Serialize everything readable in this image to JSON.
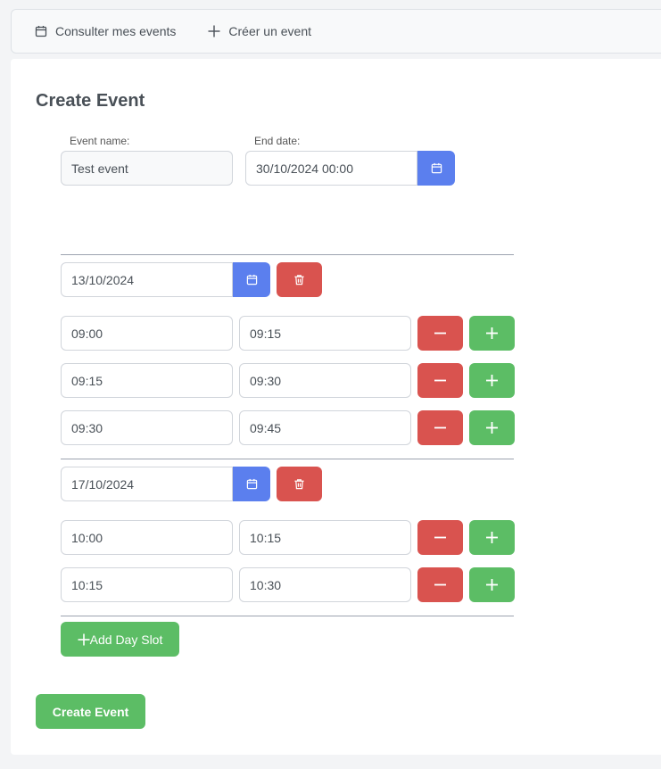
{
  "nav": {
    "view_events": "Consulter mes events",
    "create_event": "Créer un event"
  },
  "form": {
    "title": "Create Event",
    "event_name_label": "Event name:",
    "event_name_value": "Test event",
    "end_date_label": "End date:",
    "end_date_value": "30/10/2024 00:00"
  },
  "day_slots": [
    {
      "date": "13/10/2024",
      "slots": [
        {
          "start": "09:00",
          "end": "09:15"
        },
        {
          "start": "09:15",
          "end": "09:30"
        },
        {
          "start": "09:30",
          "end": "09:45"
        }
      ]
    },
    {
      "date": "17/10/2024",
      "slots": [
        {
          "start": "10:00",
          "end": "10:15"
        },
        {
          "start": "10:15",
          "end": "10:30"
        }
      ]
    }
  ],
  "buttons": {
    "add_day_slot": "Add Day Slot",
    "create_event": "Create Event"
  },
  "colors": {
    "primary": "#5b7fee",
    "danger": "#d9534f",
    "success": "#5cbd65"
  }
}
